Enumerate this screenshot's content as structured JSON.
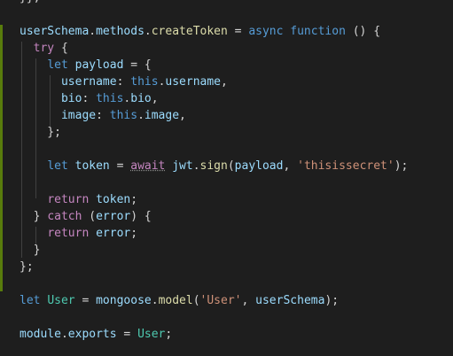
{
  "editor": {
    "background": "#1e1e1e",
    "git_modified_color": "#587c0c",
    "lines": [
      [
        [
          "pl",
          "}};"
        ]
      ],
      [],
      [
        [
          "var",
          "userSchema"
        ],
        [
          "pl",
          "."
        ],
        [
          "var",
          "methods"
        ],
        [
          "pl",
          "."
        ],
        [
          "fn",
          "createToken"
        ],
        [
          "pl",
          " = "
        ],
        [
          "kw",
          "async"
        ],
        [
          "pl",
          " "
        ],
        [
          "kw",
          "function"
        ],
        [
          "pl",
          " () {"
        ]
      ],
      [
        [
          "pl",
          "  "
        ],
        [
          "ctl",
          "try"
        ],
        [
          "pl",
          " {"
        ]
      ],
      [
        [
          "pl",
          "    "
        ],
        [
          "kw",
          "let"
        ],
        [
          "pl",
          " "
        ],
        [
          "var",
          "payload"
        ],
        [
          "pl",
          " = {"
        ]
      ],
      [
        [
          "pl",
          "      "
        ],
        [
          "var",
          "username"
        ],
        [
          "pl",
          ": "
        ],
        [
          "kw",
          "this"
        ],
        [
          "pl",
          "."
        ],
        [
          "var",
          "username"
        ],
        [
          "pl",
          ","
        ]
      ],
      [
        [
          "pl",
          "      "
        ],
        [
          "var",
          "bio"
        ],
        [
          "pl",
          ": "
        ],
        [
          "kw",
          "this"
        ],
        [
          "pl",
          "."
        ],
        [
          "var",
          "bio"
        ],
        [
          "pl",
          ","
        ]
      ],
      [
        [
          "pl",
          "      "
        ],
        [
          "var",
          "image"
        ],
        [
          "pl",
          ": "
        ],
        [
          "kw",
          "this"
        ],
        [
          "pl",
          "."
        ],
        [
          "var",
          "image"
        ],
        [
          "pl",
          ","
        ]
      ],
      [
        [
          "pl",
          "    };"
        ]
      ],
      [],
      [
        [
          "pl",
          "    "
        ],
        [
          "kw",
          "let"
        ],
        [
          "pl",
          " "
        ],
        [
          "var",
          "token"
        ],
        [
          "pl",
          " = "
        ],
        [
          "ctl-u",
          "await"
        ],
        [
          "pl",
          " "
        ],
        [
          "var",
          "jwt"
        ],
        [
          "pl",
          "."
        ],
        [
          "fn",
          "sign"
        ],
        [
          "pl",
          "("
        ],
        [
          "var",
          "payload"
        ],
        [
          "pl",
          ", "
        ],
        [
          "str",
          "'thisissecret'"
        ],
        [
          "pl",
          ");"
        ]
      ],
      [],
      [
        [
          "pl",
          "    "
        ],
        [
          "ctl",
          "return"
        ],
        [
          "pl",
          " "
        ],
        [
          "var",
          "token"
        ],
        [
          "pl",
          ";"
        ]
      ],
      [
        [
          "pl",
          "  } "
        ],
        [
          "ctl",
          "catch"
        ],
        [
          "pl",
          " ("
        ],
        [
          "var",
          "error"
        ],
        [
          "pl",
          ") {"
        ]
      ],
      [
        [
          "pl",
          "    "
        ],
        [
          "ctl",
          "return"
        ],
        [
          "pl",
          " "
        ],
        [
          "var",
          "error"
        ],
        [
          "pl",
          ";"
        ]
      ],
      [
        [
          "pl",
          "  }"
        ]
      ],
      [
        [
          "pl",
          "};"
        ]
      ],
      [],
      [
        [
          "kw",
          "let"
        ],
        [
          "pl",
          " "
        ],
        [
          "cls",
          "User"
        ],
        [
          "pl",
          " = "
        ],
        [
          "var",
          "mongoose"
        ],
        [
          "pl",
          "."
        ],
        [
          "fn",
          "model"
        ],
        [
          "pl",
          "("
        ],
        [
          "str",
          "'User'"
        ],
        [
          "pl",
          ", "
        ],
        [
          "var",
          "userSchema"
        ],
        [
          "pl",
          ");"
        ]
      ],
      [],
      [
        [
          "var",
          "module"
        ],
        [
          "pl",
          "."
        ],
        [
          "var",
          "exports"
        ],
        [
          "pl",
          " = "
        ],
        [
          "cls",
          "User"
        ],
        [
          "pl",
          ";"
        ]
      ]
    ]
  }
}
